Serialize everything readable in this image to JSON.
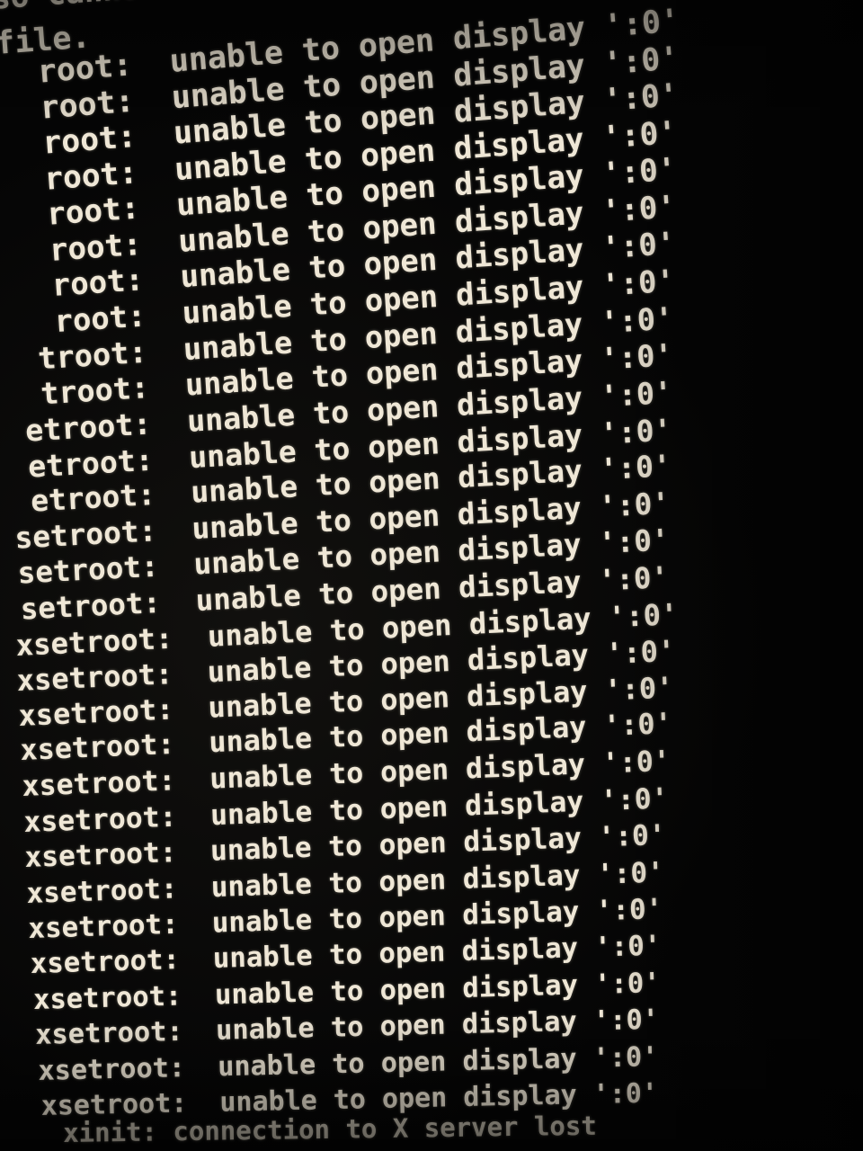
{
  "console": {
    "partial_lines": [
      "so cannot",
      "file."
    ],
    "error_lines": [
      {
        "program": "root:",
        "message": "unable to open display ':0'"
      },
      {
        "program": "root:",
        "message": "unable to open display ':0'"
      },
      {
        "program": "root:",
        "message": "unable to open display ':0'"
      },
      {
        "program": "root:",
        "message": "unable to open display ':0'"
      },
      {
        "program": "root:",
        "message": "unable to open display ':0'"
      },
      {
        "program": "root:",
        "message": "unable to open display ':0'"
      },
      {
        "program": "root:",
        "message": "unable to open display ':0'"
      },
      {
        "program": "root:",
        "message": "unable to open display ':0'"
      },
      {
        "program": "troot:",
        "message": "unable to open display ':0'"
      },
      {
        "program": "troot:",
        "message": "unable to open display ':0'"
      },
      {
        "program": "etroot:",
        "message": "unable to open display ':0'"
      },
      {
        "program": "etroot:",
        "message": "unable to open display ':0'"
      },
      {
        "program": "etroot:",
        "message": "unable to open display ':0'"
      },
      {
        "program": "setroot:",
        "message": "unable to open display ':0'"
      },
      {
        "program": "setroot:",
        "message": "unable to open display ':0'"
      },
      {
        "program": "setroot:",
        "message": "unable to open display ':0'"
      },
      {
        "program": "xsetroot:",
        "message": "unable to open display ':0'"
      },
      {
        "program": "xsetroot:",
        "message": "unable to open display ':0'"
      },
      {
        "program": "xsetroot:",
        "message": "unable to open display ':0'"
      },
      {
        "program": "xsetroot:",
        "message": "unable to open display ':0'"
      },
      {
        "program": "xsetroot:",
        "message": "unable to open display ':0'"
      },
      {
        "program": "xsetroot:",
        "message": "unable to open display ':0'"
      },
      {
        "program": "xsetroot:",
        "message": "unable to open display ':0'"
      },
      {
        "program": "xsetroot:",
        "message": "unable to open display ':0'"
      },
      {
        "program": "xsetroot:",
        "message": "unable to open display ':0'"
      },
      {
        "program": "xsetroot:",
        "message": "unable to open display ':0'"
      },
      {
        "program": "xsetroot:",
        "message": "unable to open display ':0'"
      },
      {
        "program": "xsetroot:",
        "message": "unable to open display ':0'"
      },
      {
        "program": "xsetroot:",
        "message": "unable to open display ':0'"
      },
      {
        "program": "xsetroot:",
        "message": "unable to open display ':0'"
      }
    ],
    "final_line": "xinit: connection to X server lost"
  }
}
